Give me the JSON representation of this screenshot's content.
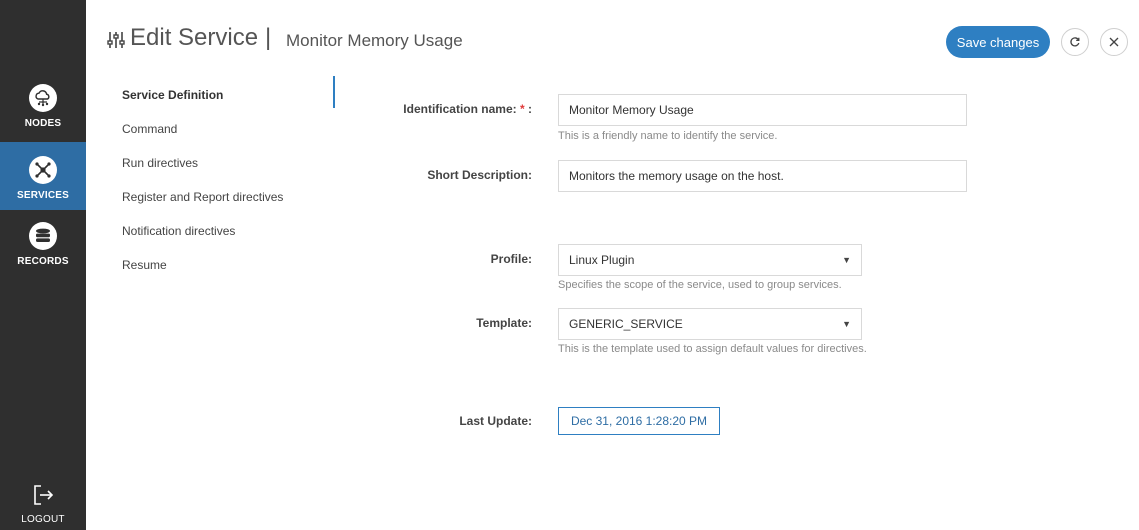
{
  "nav": {
    "nodes_label": "NODES",
    "services_label": "SERVICES",
    "records_label": "RECORDS",
    "logout_label": "LOGOUT",
    "active": "SERVICES",
    "active_color": "#2e6da4",
    "background": "#2f2f2f"
  },
  "header": {
    "icon": "sliders-icon",
    "title": "Edit Service",
    "separator": "|",
    "subtitle": "Monitor Memory Usage",
    "save_label": "Save changes",
    "refresh_icon": "refresh-icon",
    "close_icon": "close-icon"
  },
  "sections": {
    "items": [
      "Service Definition",
      "Command",
      "Run directives",
      "Register and Report directives",
      "Notification directives",
      "Resume"
    ],
    "active": "Service Definition"
  },
  "form": {
    "id_name_label": "Identification name:",
    "id_name_required": "*",
    "id_name_colon": " :",
    "id_name_value": "Monitor Memory Usage",
    "id_name_help": "This is a friendly name to identify the service.",
    "short_desc_label": "Short Description:",
    "short_desc_value": "Monitors the memory usage on the host.",
    "profile_label": "Profile:",
    "profile_value": "Linux Plugin",
    "profile_help": "Specifies the scope of the service, used to group services.",
    "template_label": "Template:",
    "template_value": "GENERIC_SERVICE",
    "template_help": "This is the template used to assign default values for directives.",
    "last_update_label": "Last Update:",
    "last_update_value": "Dec 31, 2016 1:28:20 PM"
  },
  "colors": {
    "accent": "#2e7fc2",
    "required": "#e03a3a"
  }
}
